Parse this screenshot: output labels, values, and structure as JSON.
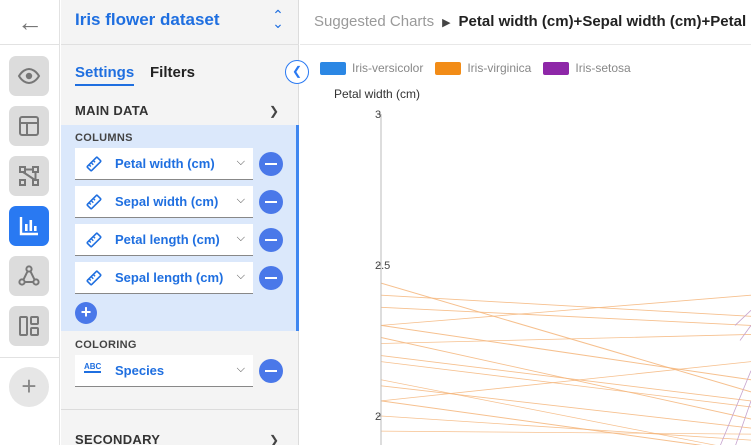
{
  "rail": {
    "back_icon": "arrow-left-icon",
    "buttons": [
      "eye-icon",
      "layout-icon",
      "workflow-icon",
      "bar-chart-icon",
      "network-icon",
      "dashboard-icon"
    ],
    "active_button": "bar-chart-icon",
    "add_icon": "plus-icon",
    "accent": "#2979f2"
  },
  "panel": {
    "dataset_title": "Iris flower dataset",
    "tabs": {
      "settings": "Settings",
      "filters": "Filters"
    },
    "main_data": {
      "title": "MAIN DATA",
      "columns_label": "COLUMNS",
      "columns": [
        {
          "label": "Petal width (cm)",
          "icon": "numeric-ruler-icon"
        },
        {
          "label": "Sepal width (cm)",
          "icon": "numeric-ruler-icon"
        },
        {
          "label": "Petal length (cm)",
          "icon": "numeric-ruler-icon"
        },
        {
          "label": "Sepal length (cm)",
          "icon": "numeric-ruler-icon"
        }
      ],
      "coloring_label": "COLORING",
      "coloring": {
        "label": "Species",
        "icon": "text-abc-icon"
      }
    },
    "secondary_title": "SECONDARY"
  },
  "main": {
    "breadcrumb_root": "Suggested Charts",
    "breadcrumb_current": "Petal width (cm)+Sepal width (cm)+Petal length (cm)+Sepal length (cm)"
  },
  "chart_data": {
    "type": "parallel-coordinates",
    "legend": [
      {
        "name": "Iris-versicolor",
        "color": "#2b87e4"
      },
      {
        "name": "Iris-virginica",
        "color": "#f28c17"
      },
      {
        "name": "Iris-setosa",
        "color": "#8e27a8"
      }
    ],
    "first_axis": {
      "title": "Petal width (cm)",
      "ticks": [
        "3",
        "2.5",
        "2"
      ],
      "tick_values": [
        3,
        2.5,
        2
      ],
      "visible_range": [
        1.9,
        3
      ]
    },
    "visible_series": {
      "Iris-virginica": {
        "line_color": "#f5b57a"
      },
      "Iris-setosa": {
        "line_color": "#c7a4cf"
      }
    }
  }
}
